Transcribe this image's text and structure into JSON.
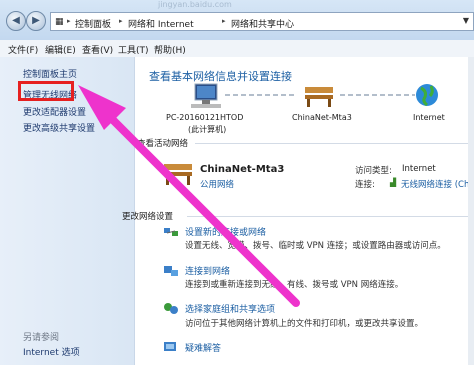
{
  "window": {
    "url_overlay": "jingyan.baidu.com",
    "breadcrumb": [
      "控制面板",
      "网络和 Internet",
      "网络和共享中心"
    ]
  },
  "menu": [
    "文件(F)",
    "编辑(E)",
    "查看(V)",
    "工具(T)",
    "帮助(H)"
  ],
  "sidebar": {
    "items": [
      "控制面板主页",
      "管理无线网络",
      "更改适配器设置",
      "更改高级共享设置"
    ],
    "see_also": "另请参阅",
    "internet_options": "Internet 选项"
  },
  "main": {
    "title": "查看基本网络信息并设置连接",
    "map": {
      "computer": "PC-20160121HTOD",
      "computer_sub": "(此计算机)",
      "network": "ChinaNet-Mta3",
      "internet": "Internet"
    },
    "active_header": "查看活动网络",
    "active": {
      "name": "ChinaNet-Mta3",
      "category": "公用网络",
      "access_label": "访问类型:",
      "access_value": "Internet",
      "conn_label": "连接:",
      "conn_value": "无线网络连接 (Chi"
    },
    "settings_header": "更改网络设置",
    "tasks": [
      {
        "title": "设置新的连接或网络",
        "desc": "设置无线、宽带、拨号、临时或 VPN 连接；或设置路由器或访问点。"
      },
      {
        "title": "连接到网络",
        "desc": "连接到或重新连接到无线、有线、拨号或 VPN 网络连接。"
      },
      {
        "title": "选择家庭组和共享选项",
        "desc": "访问位于其他网络计算机上的文件和打印机，或更改共享设置。"
      },
      {
        "title": "疑难解答",
        "desc": ""
      }
    ]
  },
  "colors": {
    "link": "#1c5fa3",
    "highlight": "#e62020",
    "arrow": "#ee33cc"
  }
}
